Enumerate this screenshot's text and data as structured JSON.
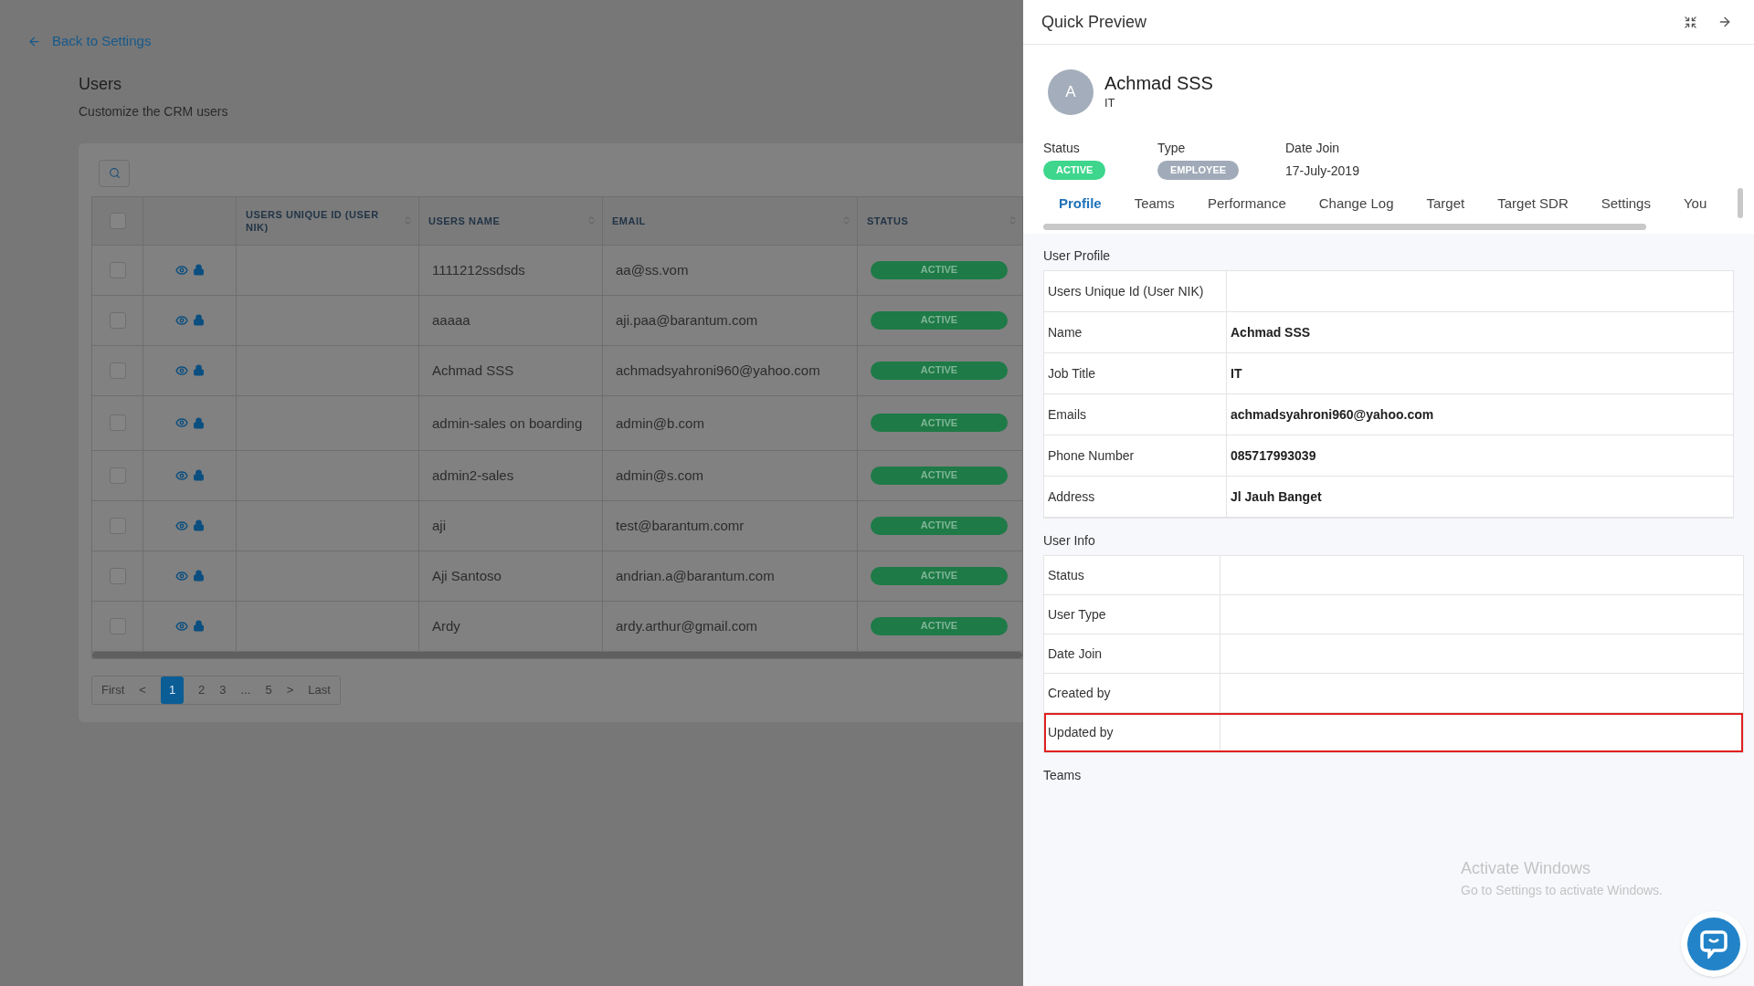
{
  "back_link": "Back to Settings",
  "page": {
    "title": "Users",
    "subtitle": "Customize the CRM users"
  },
  "table": {
    "all_checked": false,
    "columns": [
      {
        "kind": "checkbox"
      },
      {
        "kind": "actions"
      },
      {
        "label": "USERS UNIQUE ID (USER NIK)",
        "kind": "sortable"
      },
      {
        "label": "USERS NAME",
        "kind": "sortable"
      },
      {
        "label": "EMAIL",
        "kind": "sortable"
      },
      {
        "label": "STATUS",
        "kind": "sortable"
      }
    ],
    "rows": [
      {
        "name": "1111212ssdsds",
        "email": "aa@ss.vom",
        "status": "ACTIVE",
        "checked": false
      },
      {
        "name": "aaaaa",
        "email": "aji.paa@barantum.com",
        "status": "ACTIVE",
        "checked": false
      },
      {
        "name": "Achmad SSS",
        "email": "achmadsyahroni960@yahoo.com",
        "status": "ACTIVE",
        "checked": false
      },
      {
        "name": "admin-sales on boarding",
        "email": "admin@b.com",
        "status": "ACTIVE",
        "checked": false
      },
      {
        "name": "admin2-sales",
        "email": "admin@s.com",
        "status": "ACTIVE",
        "checked": false
      },
      {
        "name": "aji",
        "email": "test@barantum.comr",
        "status": "ACTIVE",
        "checked": false
      },
      {
        "name": "Aji Santoso",
        "email": "andrian.a@barantum.com",
        "status": "ACTIVE",
        "checked": false
      },
      {
        "name": "Ardy",
        "email": "ardy.arthur@gmail.com",
        "status": "ACTIVE",
        "checked": false
      }
    ]
  },
  "pagination": [
    {
      "label": "First",
      "selected": false
    },
    {
      "label": "<",
      "selected": false
    },
    {
      "label": "1",
      "selected": true
    },
    {
      "label": "2",
      "selected": false
    },
    {
      "label": "3",
      "selected": false
    },
    {
      "label": "...",
      "selected": false
    },
    {
      "label": "5",
      "selected": false
    },
    {
      "label": ">",
      "selected": false
    },
    {
      "label": "Last",
      "selected": false
    }
  ],
  "preview": {
    "title": "Quick Preview",
    "user": {
      "initial": "A",
      "name": "Achmad SSS",
      "job": "IT"
    },
    "summary": [
      {
        "label": "Status",
        "value": "ACTIVE",
        "kind": "badge",
        "color": "#3dd68c"
      },
      {
        "label": "Type",
        "value": "EMPLOYEE",
        "kind": "badge",
        "color": "#a0aab8"
      },
      {
        "label": "Date Join",
        "value": "17-July-2019",
        "kind": "text"
      }
    ],
    "tabs": [
      {
        "label": "Profile",
        "selected": true
      },
      {
        "label": "Teams",
        "selected": false
      },
      {
        "label": "Performance",
        "selected": false
      },
      {
        "label": "Change Log",
        "selected": false
      },
      {
        "label": "Target",
        "selected": false
      },
      {
        "label": "Target SDR",
        "selected": false
      },
      {
        "label": "Settings",
        "selected": false
      },
      {
        "label": "You",
        "selected": false
      }
    ],
    "sections": [
      {
        "title": "User Profile",
        "rows": [
          {
            "label": "Users Unique Id (User NIK)",
            "highlighted": false
          },
          {
            "label": "Name",
            "value": "Achmad SSS",
            "highlighted": false
          },
          {
            "label": "Job Title",
            "value": "IT",
            "highlighted": false
          },
          {
            "label": "Emails",
            "value": "achmadsyahroni960@yahoo.com",
            "highlighted": false
          },
          {
            "label": "Phone Number",
            "value": "085717993039",
            "highlighted": false
          },
          {
            "label": "Address",
            "value": "Jl Jauh Banget",
            "highlighted": false
          }
        ]
      },
      {
        "title": "User Info",
        "rows": [
          {
            "label": "Status",
            "highlighted": false
          },
          {
            "label": "User Type",
            "highlighted": false
          },
          {
            "label": "Date Join",
            "highlighted": false
          },
          {
            "label": "Created by",
            "highlighted": false
          },
          {
            "label": "Updated by",
            "highlighted": true
          }
        ]
      },
      {
        "title": "Teams"
      }
    ]
  },
  "os_notice": {
    "title": "Activate Windows",
    "text": "Go to Settings to activate Windows."
  }
}
